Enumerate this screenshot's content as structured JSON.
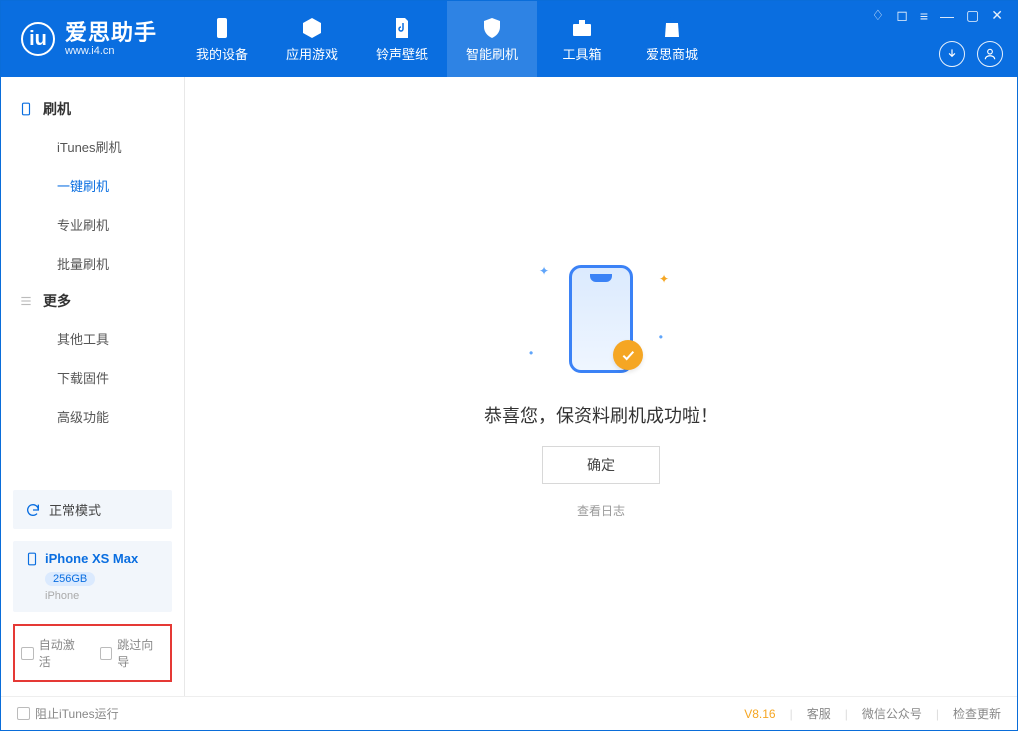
{
  "header": {
    "app_name": "爱思助手",
    "app_url": "www.i4.cn",
    "tabs": [
      {
        "label": "我的设备"
      },
      {
        "label": "应用游戏"
      },
      {
        "label": "铃声壁纸"
      },
      {
        "label": "智能刷机"
      },
      {
        "label": "工具箱"
      },
      {
        "label": "爱思商城"
      }
    ]
  },
  "sidebar": {
    "group1": {
      "title": "刷机",
      "items": [
        "iTunes刷机",
        "一键刷机",
        "专业刷机",
        "批量刷机"
      ]
    },
    "group2": {
      "title": "更多",
      "items": [
        "其他工具",
        "下载固件",
        "高级功能"
      ]
    },
    "mode_label": "正常模式",
    "device": {
      "name": "iPhone XS Max",
      "capacity": "256GB",
      "type": "iPhone"
    },
    "checks": {
      "auto_activate": "自动激活",
      "skip_guide": "跳过向导"
    }
  },
  "main": {
    "success_msg": "恭喜您，保资料刷机成功啦！",
    "ok_label": "确定",
    "log_link": "查看日志"
  },
  "footer": {
    "block_itunes": "阻止iTunes运行",
    "version": "V8.16",
    "links": [
      "客服",
      "微信公众号",
      "检查更新"
    ]
  }
}
